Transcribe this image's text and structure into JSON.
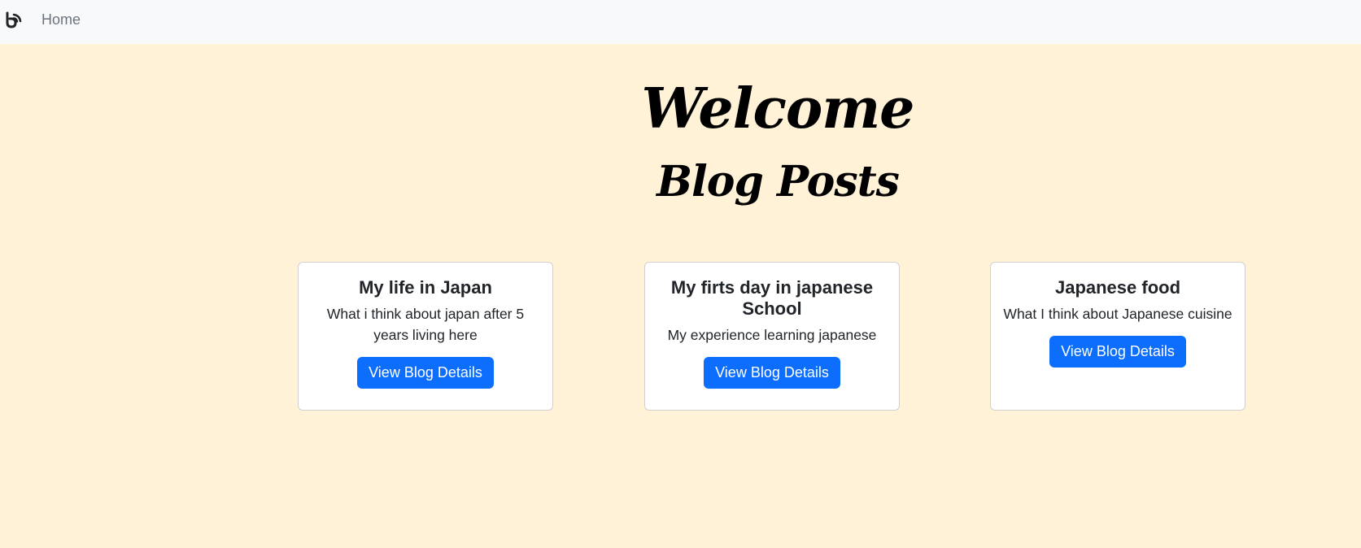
{
  "nav": {
    "brand_icon": "blog-logo-icon",
    "links": [
      {
        "label": "Home"
      }
    ]
  },
  "hero": {
    "title": "Welcome",
    "subtitle": "Blog Posts"
  },
  "posts": [
    {
      "title": "My life in Japan",
      "description": "What i think about japan after 5 years living here",
      "button_label": "View Blog Details"
    },
    {
      "title": "My firts day in japanese School",
      "description": "My experience learning japanese",
      "button_label": "View Blog Details"
    },
    {
      "title": "Japanese food",
      "description": "What I think about Japanese cuisine",
      "button_label": "View Blog Details"
    }
  ],
  "colors": {
    "page_background": "#fff2d7",
    "navbar_background": "#f8f9fa",
    "primary_button": "#0d6efd"
  }
}
